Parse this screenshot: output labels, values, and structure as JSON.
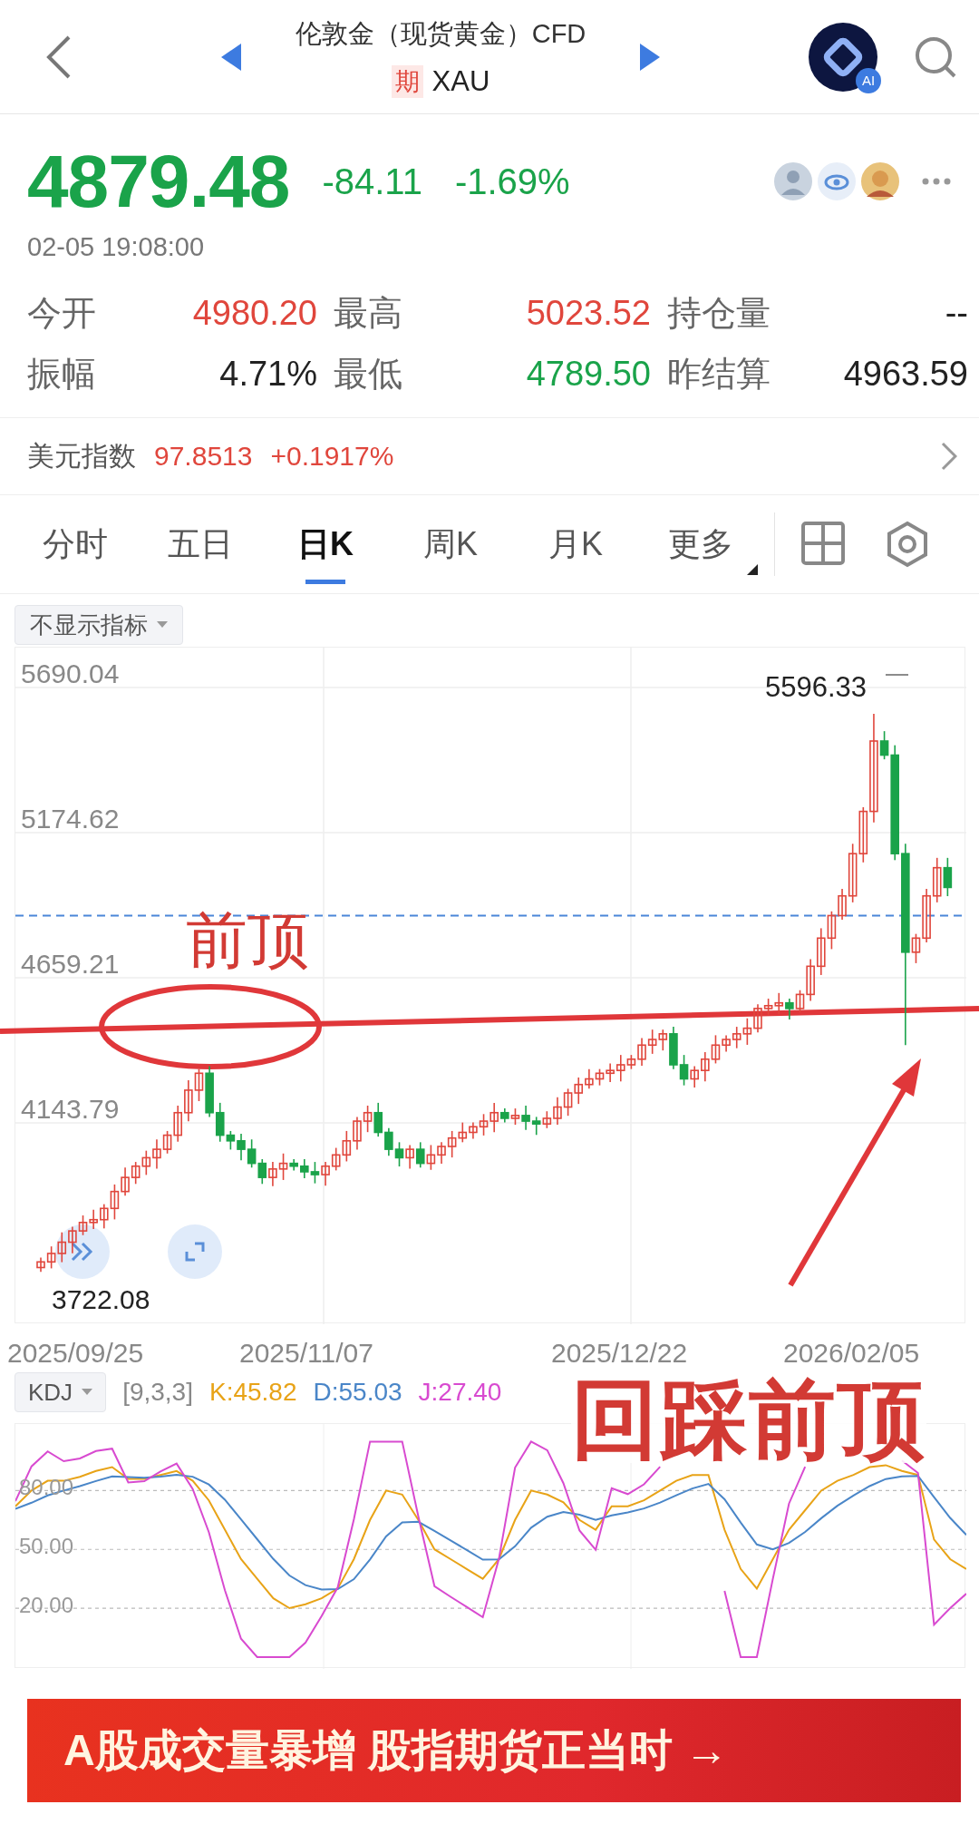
{
  "header": {
    "title": "伦敦金（现货黄金）CFD",
    "badge": "期",
    "symbol": "XAU",
    "ai_badge": "AI"
  },
  "quote": {
    "price": "4879.48",
    "change": "-84.11",
    "change_percent": "-1.69%",
    "color": "#1aa34a",
    "time": "02-05 19:08:00"
  },
  "stats": [
    {
      "label": "今开",
      "value": "4980.20",
      "color": "#e0463c"
    },
    {
      "label": "最高",
      "value": "5023.52",
      "color": "#e0463c"
    },
    {
      "label": "持仓量",
      "value": "--",
      "color": "#222222"
    },
    {
      "label": "振幅",
      "value": "4.71%",
      "color": "#222222"
    },
    {
      "label": "最低",
      "value": "4789.50",
      "color": "#1aa34a"
    },
    {
      "label": "昨结算",
      "value": "4963.59",
      "color": "#222222"
    }
  ],
  "usd_index": {
    "label": "美元指数",
    "value": "97.8513",
    "change": "+0.1917%"
  },
  "tabs": [
    {
      "label": "分时",
      "selected": false,
      "kind": "period"
    },
    {
      "label": "五日",
      "selected": false,
      "kind": "period"
    },
    {
      "label": "日K",
      "selected": true,
      "kind": "period"
    },
    {
      "label": "周K",
      "selected": false,
      "kind": "period"
    },
    {
      "label": "月K",
      "selected": false,
      "kind": "period"
    },
    {
      "label": "更多",
      "selected": false,
      "kind": "menu"
    }
  ],
  "chart": {
    "indicator_dropdown": "不显示指标",
    "min_label": "3722.08",
    "max_label": "5596.33",
    "chart_data": {
      "type": "candlestick",
      "grid": true,
      "ylim": [
        3428.6,
        5831.8
      ],
      "ref_lines": [
        {
          "axis": "y",
          "value": 4879.48
        }
      ],
      "yticks": [
        {
          "value": 5690.04,
          "label": "5690.04"
        },
        {
          "value": 5174.62,
          "label": "5174.62"
        },
        {
          "value": 4659.21,
          "label": "4659.21"
        },
        {
          "value": 4143.79,
          "label": "4143.79"
        }
      ],
      "ohlc": [
        [
          3630,
          3665,
          3615,
          3650
        ],
        [
          3650,
          3705,
          3627,
          3680
        ],
        [
          3680,
          3755,
          3649,
          3720
        ],
        [
          3720,
          3775,
          3681,
          3760
        ],
        [
          3760,
          3815,
          3745,
          3790
        ],
        [
          3790,
          3835,
          3767,
          3800
        ],
        [
          3800,
          3855,
          3769,
          3840
        ],
        [
          3840,
          3925,
          3801,
          3900
        ],
        [
          3900,
          3985,
          3885,
          3950
        ],
        [
          3950,
          4005,
          3927,
          3990
        ],
        [
          3990,
          4045,
          3959,
          4020
        ],
        [
          4020,
          4085,
          3981,
          4050
        ],
        [
          4050,
          4115,
          4035,
          4100
        ],
        [
          4100,
          4205,
          4077,
          4180
        ],
        [
          4180,
          4295,
          4149,
          4260
        ],
        [
          4260,
          4335,
          4221,
          4320
        ],
        [
          4320,
          4345,
          4165,
          4180
        ],
        [
          4180,
          4215,
          4077,
          4100
        ],
        [
          4100,
          4115,
          4049,
          4080
        ],
        [
          4080,
          4105,
          4011,
          4050
        ],
        [
          4050,
          4085,
          3985,
          4000
        ],
        [
          4000,
          4015,
          3927,
          3950
        ],
        [
          3950,
          4005,
          3919,
          3980
        ],
        [
          3980,
          4035,
          3941,
          4000
        ],
        [
          4000,
          4015,
          3975,
          3990
        ],
        [
          3990,
          4015,
          3947,
          3970
        ],
        [
          3970,
          4005,
          3929,
          3960
        ],
        [
          3960,
          4005,
          3921,
          3990
        ],
        [
          3990,
          4055,
          3975,
          4030
        ],
        [
          4030,
          4115,
          4007,
          4080
        ],
        [
          4080,
          4165,
          4049,
          4150
        ],
        [
          4150,
          4205,
          4111,
          4180
        ],
        [
          4180,
          4215,
          4095,
          4110
        ],
        [
          4110,
          4125,
          4027,
          4050
        ],
        [
          4050,
          4075,
          3989,
          4020
        ],
        [
          4020,
          4065,
          3981,
          4050
        ],
        [
          4050,
          4075,
          3985,
          4000
        ],
        [
          4000,
          4065,
          3977,
          4030
        ],
        [
          4030,
          4075,
          3999,
          4060
        ],
        [
          4060,
          4115,
          4021,
          4090
        ],
        [
          4090,
          4145,
          4075,
          4110
        ],
        [
          4110,
          4145,
          4087,
          4130
        ],
        [
          4130,
          4175,
          4099,
          4150
        ],
        [
          4150,
          4215,
          4111,
          4180
        ],
        [
          4180,
          4195,
          4145,
          4160
        ],
        [
          4160,
          4195,
          4137,
          4170
        ],
        [
          4170,
          4205,
          4119,
          4150
        ],
        [
          4150,
          4165,
          4101,
          4140
        ],
        [
          4140,
          4185,
          4125,
          4160
        ],
        [
          4160,
          4235,
          4137,
          4200
        ],
        [
          4200,
          4265,
          4169,
          4250
        ],
        [
          4250,
          4305,
          4211,
          4280
        ],
        [
          4280,
          4335,
          4265,
          4300
        ],
        [
          4300,
          4335,
          4277,
          4320
        ],
        [
          4320,
          4355,
          4289,
          4330
        ],
        [
          4330,
          4385,
          4291,
          4350
        ],
        [
          4350,
          4385,
          4335,
          4370
        ],
        [
          4370,
          4445,
          4347,
          4420
        ],
        [
          4420,
          4475,
          4389,
          4440
        ],
        [
          4440,
          4475,
          4401,
          4460
        ],
        [
          4460,
          4485,
          4335,
          4350
        ],
        [
          4350,
          4385,
          4277,
          4300
        ],
        [
          4300,
          4345,
          4269,
          4330
        ],
        [
          4330,
          4395,
          4291,
          4370
        ],
        [
          4370,
          4455,
          4355,
          4420
        ],
        [
          4420,
          4455,
          4397,
          4440
        ],
        [
          4440,
          4485,
          4409,
          4460
        ],
        [
          4460,
          4515,
          4421,
          4480
        ],
        [
          4480,
          4565,
          4465,
          4550
        ],
        [
          4550,
          4585,
          4527,
          4560
        ],
        [
          4560,
          4605,
          4529,
          4570
        ],
        [
          4570,
          4585,
          4511,
          4550
        ],
        [
          4550,
          4615,
          4535,
          4600
        ],
        [
          4600,
          4725,
          4577,
          4700
        ],
        [
          4700,
          4835,
          4669,
          4800
        ],
        [
          4800,
          4895,
          4761,
          4880
        ],
        [
          4880,
          4975,
          4865,
          4950
        ],
        [
          4950,
          5135,
          4927,
          5100
        ],
        [
          5100,
          5265,
          5069,
          5250
        ],
        [
          5250,
          5596.33,
          5211,
          5500
        ],
        [
          5500,
          5535,
          5435,
          5450
        ],
        [
          5450,
          5485,
          5077,
          5100
        ],
        [
          5100,
          5135,
          4420,
          4750
        ],
        [
          4750,
          4815,
          4711,
          4800
        ],
        [
          4800,
          4975,
          4785,
          4950
        ],
        [
          4950,
          5085,
          4927,
          5050
        ],
        [
          5050,
          5085,
          4949,
          4980
        ]
      ]
    },
    "dates": [
      "2025/09/25",
      "2025/11/07",
      "2025/12/22",
      "2026/02/05"
    ],
    "annotations": [
      {
        "text": "前顶"
      },
      {
        "text": "回踩前顶"
      }
    ]
  },
  "kdj": {
    "dropdown": "KDJ",
    "params": "[9,3,3]",
    "chart_data": {
      "type": "line",
      "grid": true,
      "ylim": [
        -11,
        114
      ],
      "yticks": [
        {
          "value": 80,
          "label": "80.00"
        },
        {
          "value": 50,
          "label": "50.00"
        },
        {
          "value": 20,
          "label": "20.00"
        }
      ],
      "series": [
        {
          "name": "K:45.82",
          "color": "#e8a317",
          "values": [
            72,
            80,
            85,
            85,
            87,
            90,
            92,
            86,
            86,
            88,
            90,
            85,
            75,
            60,
            45,
            35,
            25,
            20,
            22,
            25,
            30,
            45,
            65,
            80,
            78,
            65,
            50,
            45,
            40,
            35,
            45,
            65,
            80,
            78,
            74,
            65,
            60,
            72,
            72,
            75,
            80,
            85,
            88,
            88,
            60,
            40,
            30,
            45,
            60,
            70,
            80,
            85,
            88,
            92,
            93,
            90,
            88,
            55,
            45,
            40
          ]
        },
        {
          "name": "D:55.03",
          "color": "#4a86c8",
          "values": [
            70.7,
            73.8,
            77.5,
            80,
            82.3,
            84.9,
            87.3,
            86.9,
            86.6,
            87.1,
            88.1,
            87.1,
            83.1,
            75.4,
            65.3,
            55.2,
            45.1,
            36.7,
            31.8,
            29.5,
            29.7,
            34.8,
            44.9,
            56.6,
            63.7,
            64.1,
            59.4,
            54.6,
            49.7,
            44.8,
            44.9,
            51.6,
            61.1,
            66.7,
            69.1,
            67.7,
            65.1,
            67.4,
            68.9,
            70.9,
            73.9,
            77.6,
            81.1,
            83.4,
            75.6,
            63.7,
            52.5,
            50,
            53.3,
            58.9,
            65.9,
            72.3,
            77.5,
            82.3,
            85.9,
            87.3,
            87.5,
            76.7,
            66.1,
            57.4
          ]
        },
        {
          "name": "J:27.40",
          "color": "#d84ad0",
          "values": [
            74.6,
            92.4,
            100,
            95,
            96.4,
            100.2,
            101.4,
            84.2,
            84.8,
            89.8,
            93.8,
            80.8,
            58.8,
            29.2,
            4.4,
            -5,
            -5,
            -5,
            2.4,
            16,
            30.6,
            65.4,
            105,
            105,
            105,
            66.8,
            31.2,
            25.8,
            20.6,
            15.4,
            45.2,
            91.8,
            105,
            100.6,
            83.8,
            59.6,
            49.8,
            81.2,
            78.2,
            83.2,
            92.2,
            null,
            null,
            null,
            28.8,
            -5,
            -5,
            35,
            73.4,
            92.2,
            null,
            null,
            null,
            null,
            null,
            95.4,
            89,
            11.6,
            20,
            27.4
          ]
        }
      ]
    }
  },
  "banner": {
    "text": "A股成交量暴增 股指期货正当时 →"
  }
}
